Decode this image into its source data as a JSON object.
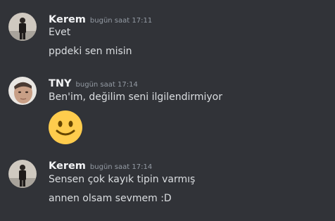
{
  "groups": [
    {
      "username": "Kerem",
      "timestamp": "bugün saat 17:11",
      "avatar_icon": "person-standing-avatar",
      "messages": [
        "Evet",
        "ppdeki sen misin"
      ]
    },
    {
      "username": "TNY",
      "timestamp": "bugün saat 17:14",
      "avatar_icon": "face-portrait-avatar",
      "messages": [
        "Ben'im, değilim seni ilgilendirmiyor"
      ],
      "emoji": "slightly-smiling-face"
    },
    {
      "username": "Kerem",
      "timestamp": "bugün saat 17:14",
      "avatar_icon": "person-standing-avatar",
      "messages": [
        "Sensen çok kayık tipin varmış",
        "annen olsam sevmem :D"
      ]
    }
  ],
  "colors": {
    "background": "#313338",
    "username": "#f2f3f5",
    "timestamp": "#949ba4",
    "message_text": "#dbdee1",
    "emoji_yellow": "#ffcc4d"
  }
}
